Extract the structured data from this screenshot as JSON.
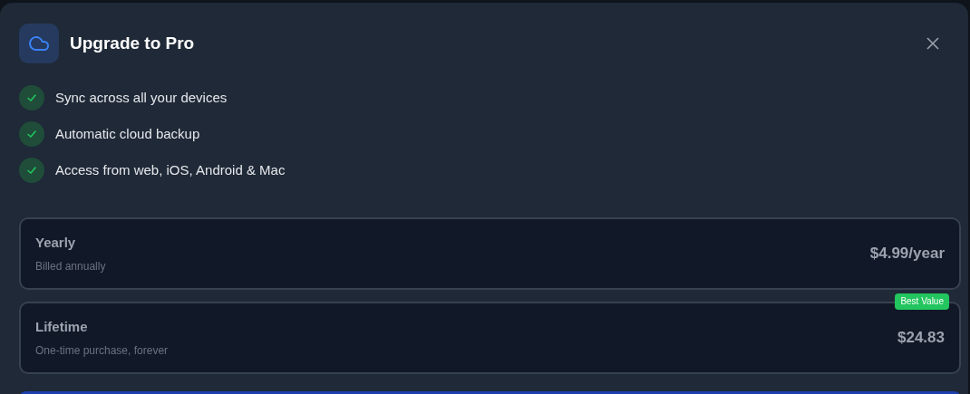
{
  "dialog": {
    "title": "Upgrade to Pro"
  },
  "features": [
    {
      "label": "Sync across all your devices"
    },
    {
      "label": "Automatic cloud backup"
    },
    {
      "label": "Access from web, iOS, Android & Mac"
    }
  ],
  "plans": [
    {
      "name": "Yearly",
      "description": "Billed annually",
      "price": "$4.99/year"
    },
    {
      "name": "Lifetime",
      "description": "One-time purchase, forever",
      "price": "$24.83",
      "badge": "Best Value"
    }
  ]
}
